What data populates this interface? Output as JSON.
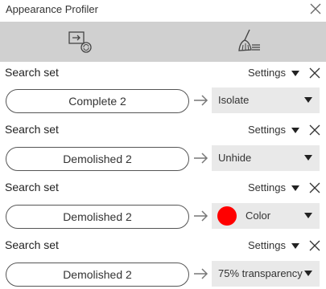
{
  "window": {
    "title": "Appearance Profiler"
  },
  "rows": [
    {
      "label": "Search set",
      "settings": "Settings",
      "set": "Complete 2",
      "action": "Isolate",
      "swatch": ""
    },
    {
      "label": "Search set",
      "settings": "Settings",
      "set": "Demolished 2",
      "action": "Unhide",
      "swatch": ""
    },
    {
      "label": "Search set",
      "settings": "Settings",
      "set": "Demolished 2",
      "action": "Color",
      "swatch": "#ff0000"
    },
    {
      "label": "Search set",
      "settings": "Settings",
      "set": "Demolished 2",
      "action": "75% transparency",
      "swatch": ""
    }
  ],
  "icons": {
    "close": "close-icon",
    "toolbar_left": "import-export-icon",
    "toolbar_right": "broom-clear-icon",
    "arrow": "arrow-right-icon"
  }
}
